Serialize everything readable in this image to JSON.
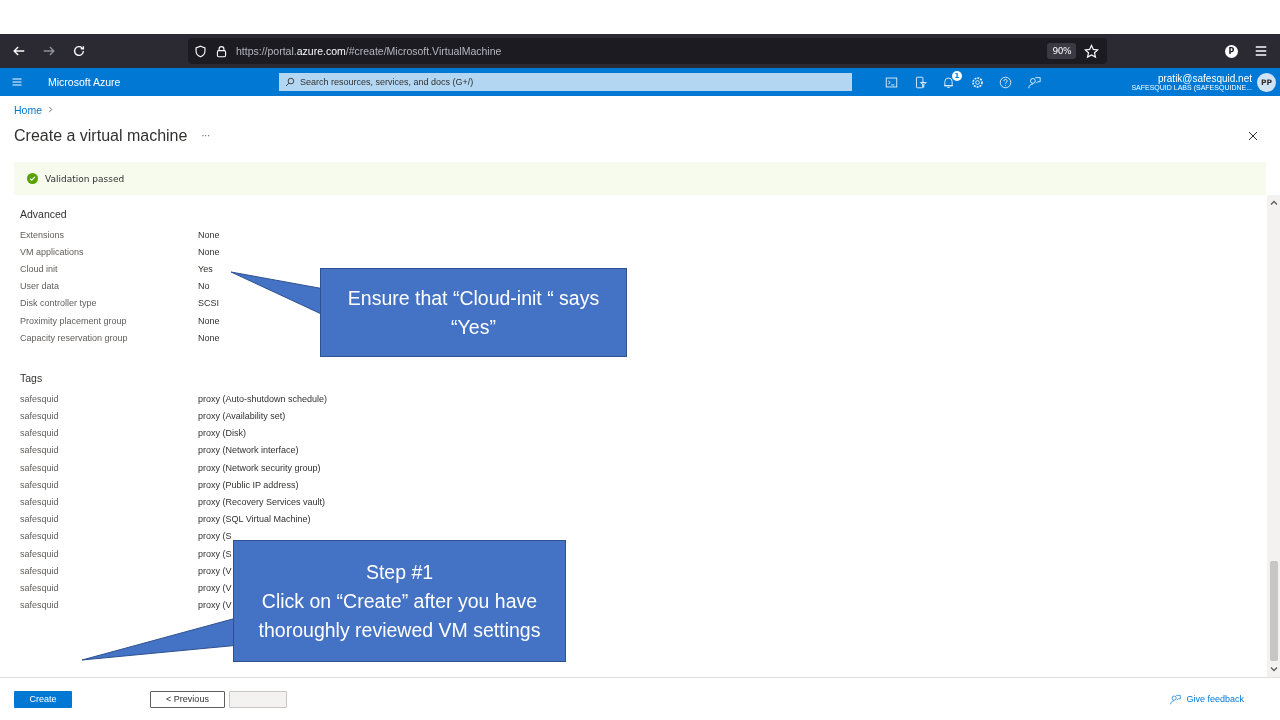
{
  "browser": {
    "url": "https://portal.**azure.com**/#create/Microsoft.VirtualMachine",
    "zoom": "90%",
    "profile_initial": "P"
  },
  "header": {
    "brand": "Microsoft Azure",
    "search": {
      "placeholder": "Search resources, services, and docs (G+/)"
    },
    "notification_count": "1",
    "account": "pratik@safesquid.net",
    "tenant": "SAFESQUID LABS (SAFESQUIDNE...",
    "avatar": "PP"
  },
  "breadcrumb": [
    "Home"
  ],
  "title": "Create a virtual machine",
  "more": "···",
  "banner": {
    "kind": "success",
    "text": "Validation passed"
  },
  "sections": [
    {
      "title": "Advanced",
      "rows": [
        {
          "label": "Extensions",
          "value": "None"
        },
        {
          "label": "VM applications",
          "value": "None"
        },
        {
          "label": "Cloud init",
          "value": "Yes"
        },
        {
          "label": "User data",
          "value": "No"
        },
        {
          "label": "Disk controller type",
          "value": "SCSI"
        },
        {
          "label": "Proximity placement group",
          "value": "None"
        },
        {
          "label": "Capacity reservation group",
          "value": "None"
        }
      ]
    },
    {
      "title": "Tags",
      "rows": [
        {
          "label": "safesquid",
          "value": "proxy (Auto-shutdown schedule)"
        },
        {
          "label": "safesquid",
          "value": "proxy (Availability set)"
        },
        {
          "label": "safesquid",
          "value": "proxy (Disk)"
        },
        {
          "label": "safesquid",
          "value": "proxy (Network interface)"
        },
        {
          "label": "safesquid",
          "value": "proxy (Network security group)"
        },
        {
          "label": "safesquid",
          "value": "proxy (Public IP address)"
        },
        {
          "label": "safesquid",
          "value": "proxy (Recovery Services vault)"
        },
        {
          "label": "safesquid",
          "value": "proxy (SQL Virtual Machine)"
        },
        {
          "label": "safesquid",
          "value": "proxy (S"
        },
        {
          "label": "safesquid",
          "value": "proxy (S"
        },
        {
          "label": "safesquid",
          "value": "proxy (V"
        },
        {
          "label": "safesquid",
          "value": "proxy (V"
        },
        {
          "label": "safesquid",
          "value": "proxy (V"
        }
      ]
    }
  ],
  "footer": {
    "buttons": [
      {
        "label": "Create",
        "kind": "primary"
      },
      {
        "label": "< Previous",
        "kind": "secondary"
      }
    ],
    "next": {
      "disabled": true
    },
    "feedback": "Give feedback"
  },
  "callouts": [
    {
      "lines": [
        "Ensure that “Cloud-init “ says “Yes”"
      ]
    },
    {
      "lines": [
        "Step #1",
        "Click on “Create” after you have thoroughly  reviewed VM settings"
      ]
    }
  ]
}
